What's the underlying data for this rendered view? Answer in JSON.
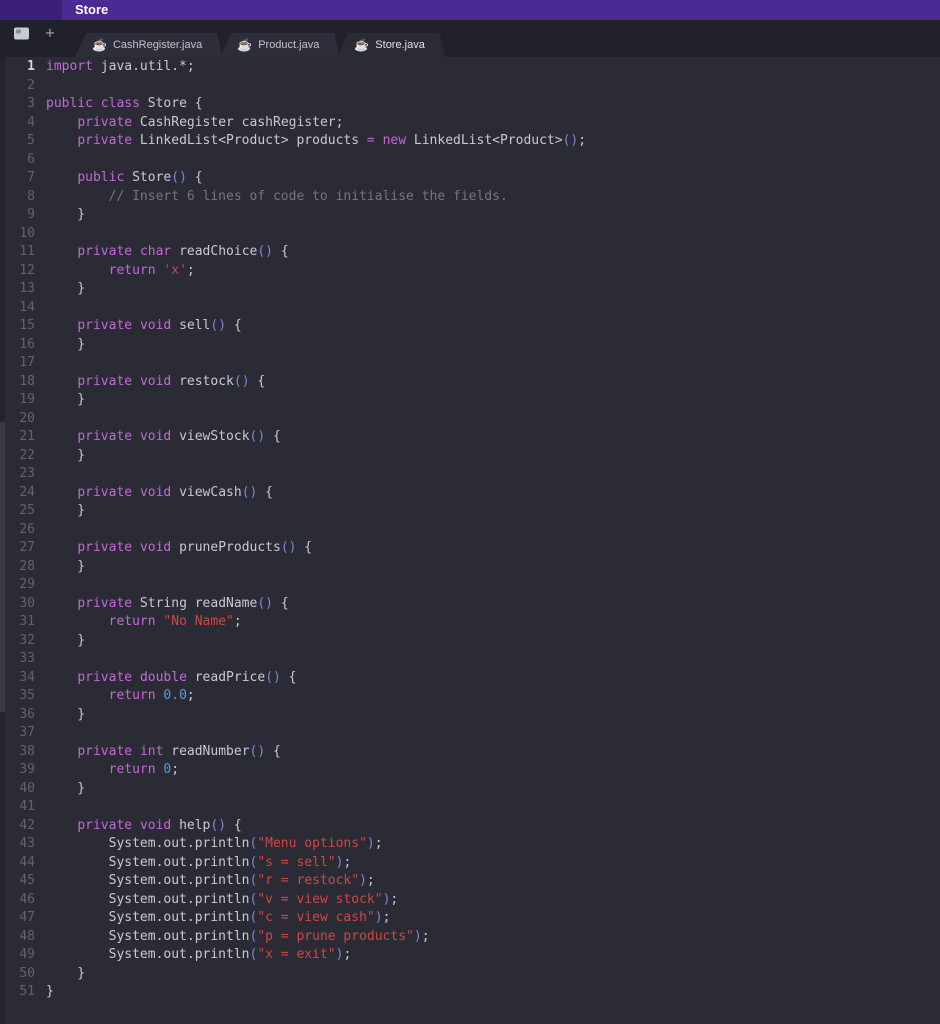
{
  "header": {
    "title": "Store"
  },
  "tabbar": {
    "plus_label": "+",
    "java_icon_glyph": "☕",
    "tabs": [
      {
        "label": "CashRegister.java",
        "active": false
      },
      {
        "label": "Product.java",
        "active": false
      },
      {
        "label": "Store.java",
        "active": true
      }
    ]
  },
  "colors": {
    "header_purple": "#4c2a94",
    "editor_bg": "#2b2b35",
    "keyword": "#c16ad4",
    "string": "#ce4747",
    "number": "#4f9fd9",
    "comment": "#75757e",
    "bracket": "#7b86d8"
  },
  "editor": {
    "current_line": "1",
    "lines": [
      {
        "n": "1",
        "tokens": [
          [
            "k",
            "import"
          ],
          [
            "p",
            " java.util.*;"
          ]
        ]
      },
      {
        "n": "2",
        "tokens": []
      },
      {
        "n": "3",
        "tokens": [
          [
            "k",
            "public"
          ],
          [
            "p",
            " "
          ],
          [
            "k",
            "class"
          ],
          [
            "p",
            " Store {"
          ]
        ]
      },
      {
        "n": "4",
        "tokens": [
          [
            "p",
            "    "
          ],
          [
            "k",
            "private"
          ],
          [
            "p",
            " CashRegister cashRegister;"
          ]
        ]
      },
      {
        "n": "5",
        "tokens": [
          [
            "p",
            "    "
          ],
          [
            "k",
            "private"
          ],
          [
            "p",
            " LinkedList<Product> products "
          ],
          [
            "o",
            "="
          ],
          [
            "p",
            " "
          ],
          [
            "k",
            "new"
          ],
          [
            "p",
            " LinkedList<Product>"
          ],
          [
            "b",
            "()"
          ],
          [
            "p",
            ";"
          ]
        ]
      },
      {
        "n": "6",
        "tokens": []
      },
      {
        "n": "7",
        "tokens": [
          [
            "p",
            "    "
          ],
          [
            "k",
            "public"
          ],
          [
            "p",
            " Store"
          ],
          [
            "b",
            "()"
          ],
          [
            "p",
            " {"
          ]
        ]
      },
      {
        "n": "8",
        "tokens": [
          [
            "c",
            "        // Insert 6 lines of code to initialise the fields."
          ]
        ]
      },
      {
        "n": "9",
        "tokens": [
          [
            "p",
            "    }"
          ]
        ]
      },
      {
        "n": "10",
        "tokens": []
      },
      {
        "n": "11",
        "tokens": [
          [
            "p",
            "    "
          ],
          [
            "k",
            "private"
          ],
          [
            "p",
            " "
          ],
          [
            "k",
            "char"
          ],
          [
            "p",
            " readChoice"
          ],
          [
            "b",
            "()"
          ],
          [
            "p",
            " {"
          ]
        ]
      },
      {
        "n": "12",
        "tokens": [
          [
            "p",
            "        "
          ],
          [
            "k",
            "return"
          ],
          [
            "p",
            " "
          ],
          [
            "s",
            "'x'"
          ],
          [
            "p",
            ";"
          ]
        ]
      },
      {
        "n": "13",
        "tokens": [
          [
            "p",
            "    }"
          ]
        ]
      },
      {
        "n": "14",
        "tokens": []
      },
      {
        "n": "15",
        "tokens": [
          [
            "p",
            "    "
          ],
          [
            "k",
            "private"
          ],
          [
            "p",
            " "
          ],
          [
            "k",
            "void"
          ],
          [
            "p",
            " sell"
          ],
          [
            "b",
            "()"
          ],
          [
            "p",
            " {"
          ]
        ]
      },
      {
        "n": "16",
        "tokens": [
          [
            "p",
            "    }"
          ]
        ]
      },
      {
        "n": "17",
        "tokens": []
      },
      {
        "n": "18",
        "tokens": [
          [
            "p",
            "    "
          ],
          [
            "k",
            "private"
          ],
          [
            "p",
            " "
          ],
          [
            "k",
            "void"
          ],
          [
            "p",
            " restock"
          ],
          [
            "b",
            "()"
          ],
          [
            "p",
            " {"
          ]
        ]
      },
      {
        "n": "19",
        "tokens": [
          [
            "p",
            "    }"
          ]
        ]
      },
      {
        "n": "20",
        "tokens": []
      },
      {
        "n": "21",
        "tokens": [
          [
            "p",
            "    "
          ],
          [
            "k",
            "private"
          ],
          [
            "p",
            " "
          ],
          [
            "k",
            "void"
          ],
          [
            "p",
            " viewStock"
          ],
          [
            "b",
            "()"
          ],
          [
            "p",
            " {"
          ]
        ]
      },
      {
        "n": "22",
        "tokens": [
          [
            "p",
            "    }"
          ]
        ]
      },
      {
        "n": "23",
        "tokens": []
      },
      {
        "n": "24",
        "tokens": [
          [
            "p",
            "    "
          ],
          [
            "k",
            "private"
          ],
          [
            "p",
            " "
          ],
          [
            "k",
            "void"
          ],
          [
            "p",
            " viewCash"
          ],
          [
            "b",
            "()"
          ],
          [
            "p",
            " {"
          ]
        ]
      },
      {
        "n": "25",
        "tokens": [
          [
            "p",
            "    }"
          ]
        ]
      },
      {
        "n": "26",
        "tokens": []
      },
      {
        "n": "27",
        "tokens": [
          [
            "p",
            "    "
          ],
          [
            "k",
            "private"
          ],
          [
            "p",
            " "
          ],
          [
            "k",
            "void"
          ],
          [
            "p",
            " pruneProducts"
          ],
          [
            "b",
            "()"
          ],
          [
            "p",
            " {"
          ]
        ]
      },
      {
        "n": "28",
        "tokens": [
          [
            "p",
            "    }"
          ]
        ]
      },
      {
        "n": "29",
        "tokens": []
      },
      {
        "n": "30",
        "tokens": [
          [
            "p",
            "    "
          ],
          [
            "k",
            "private"
          ],
          [
            "p",
            " String readName"
          ],
          [
            "b",
            "()"
          ],
          [
            "p",
            " {"
          ]
        ]
      },
      {
        "n": "31",
        "tokens": [
          [
            "p",
            "        "
          ],
          [
            "k",
            "return"
          ],
          [
            "p",
            " "
          ],
          [
            "s",
            "\"No Name\""
          ],
          [
            "p",
            ";"
          ]
        ]
      },
      {
        "n": "32",
        "tokens": [
          [
            "p",
            "    }"
          ]
        ]
      },
      {
        "n": "33",
        "tokens": []
      },
      {
        "n": "34",
        "tokens": [
          [
            "p",
            "    "
          ],
          [
            "k",
            "private"
          ],
          [
            "p",
            " "
          ],
          [
            "k",
            "double"
          ],
          [
            "p",
            " readPrice"
          ],
          [
            "b",
            "()"
          ],
          [
            "p",
            " {"
          ]
        ]
      },
      {
        "n": "35",
        "tokens": [
          [
            "p",
            "        "
          ],
          [
            "k",
            "return"
          ],
          [
            "p",
            " "
          ],
          [
            "n",
            "0.0"
          ],
          [
            "p",
            ";"
          ]
        ]
      },
      {
        "n": "36",
        "tokens": [
          [
            "p",
            "    }"
          ]
        ]
      },
      {
        "n": "37",
        "tokens": []
      },
      {
        "n": "38",
        "tokens": [
          [
            "p",
            "    "
          ],
          [
            "k",
            "private"
          ],
          [
            "p",
            " "
          ],
          [
            "k",
            "int"
          ],
          [
            "p",
            " readNumber"
          ],
          [
            "b",
            "()"
          ],
          [
            "p",
            " {"
          ]
        ]
      },
      {
        "n": "39",
        "tokens": [
          [
            "p",
            "        "
          ],
          [
            "k",
            "return"
          ],
          [
            "p",
            " "
          ],
          [
            "n",
            "0"
          ],
          [
            "p",
            ";"
          ]
        ]
      },
      {
        "n": "40",
        "tokens": [
          [
            "p",
            "    }"
          ]
        ]
      },
      {
        "n": "41",
        "tokens": []
      },
      {
        "n": "42",
        "tokens": [
          [
            "p",
            "    "
          ],
          [
            "k",
            "private"
          ],
          [
            "p",
            " "
          ],
          [
            "k",
            "void"
          ],
          [
            "p",
            " help"
          ],
          [
            "b",
            "()"
          ],
          [
            "p",
            " {"
          ]
        ]
      },
      {
        "n": "43",
        "tokens": [
          [
            "p",
            "        System.out.println"
          ],
          [
            "b",
            "("
          ],
          [
            "s",
            "\"Menu options\""
          ],
          [
            "b",
            ")"
          ],
          [
            "p",
            ";"
          ]
        ]
      },
      {
        "n": "44",
        "tokens": [
          [
            "p",
            "        System.out.println"
          ],
          [
            "b",
            "("
          ],
          [
            "s",
            "\"s = sell\""
          ],
          [
            "b",
            ")"
          ],
          [
            "p",
            ";"
          ]
        ]
      },
      {
        "n": "45",
        "tokens": [
          [
            "p",
            "        System.out.println"
          ],
          [
            "b",
            "("
          ],
          [
            "s",
            "\"r = restock\""
          ],
          [
            "b",
            ")"
          ],
          [
            "p",
            ";"
          ]
        ]
      },
      {
        "n": "46",
        "tokens": [
          [
            "p",
            "        System.out.println"
          ],
          [
            "b",
            "("
          ],
          [
            "s",
            "\"v = view stock\""
          ],
          [
            "b",
            ")"
          ],
          [
            "p",
            ";"
          ]
        ]
      },
      {
        "n": "47",
        "tokens": [
          [
            "p",
            "        System.out.println"
          ],
          [
            "b",
            "("
          ],
          [
            "s",
            "\"c = view cash\""
          ],
          [
            "b",
            ")"
          ],
          [
            "p",
            ";"
          ]
        ]
      },
      {
        "n": "48",
        "tokens": [
          [
            "p",
            "        System.out.println"
          ],
          [
            "b",
            "("
          ],
          [
            "s",
            "\"p = prune products\""
          ],
          [
            "b",
            ")"
          ],
          [
            "p",
            ";"
          ]
        ]
      },
      {
        "n": "49",
        "tokens": [
          [
            "p",
            "        System.out.println"
          ],
          [
            "b",
            "("
          ],
          [
            "s",
            "\"x = exit\""
          ],
          [
            "b",
            ")"
          ],
          [
            "p",
            ";"
          ]
        ]
      },
      {
        "n": "50",
        "tokens": [
          [
            "p",
            "    }"
          ]
        ]
      },
      {
        "n": "51",
        "tokens": [
          [
            "p",
            "}"
          ]
        ]
      }
    ]
  }
}
